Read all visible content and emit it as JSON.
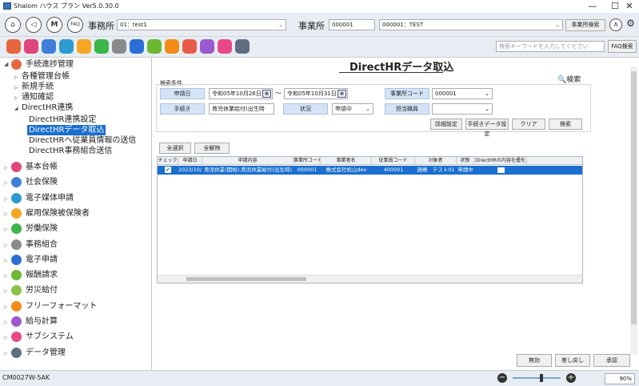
{
  "window": {
    "title": "Shalom ハウス プラン Ver5.0.30.0",
    "minimize": "—",
    "maximize": "☐",
    "close": "✕"
  },
  "toolbar": {
    "home": "⌂",
    "back": "◁",
    "m": "M",
    "faq": "FAQ",
    "office_label": "事務所",
    "office_value": "01：test1",
    "business_label": "事業所",
    "business_code": "000001",
    "business_value": "000001：TEST",
    "business_search": "事業所検索",
    "collapse": "∧",
    "settings": "⚙"
  },
  "toolbar2": {
    "icons": [
      {
        "name": "page-icon",
        "color": "#e8663d"
      },
      {
        "name": "edit-icon",
        "color": "#e0457b"
      },
      {
        "name": "cloud-icon",
        "color": "#3f7fd9"
      },
      {
        "name": "search-icon",
        "color": "#2d9bd1"
      },
      {
        "name": "people-icon",
        "color": "#f5a623"
      },
      {
        "name": "person-icon",
        "color": "#3cb54a"
      },
      {
        "name": "building-icon",
        "color": "#8a8a8a"
      },
      {
        "name": "chat-icon",
        "color": "#2b6fd6"
      },
      {
        "name": "chart-icon",
        "color": "#6cb833"
      },
      {
        "name": "doc-icon",
        "color": "#f28c18"
      },
      {
        "name": "list-icon",
        "color": "#e85b4a"
      },
      {
        "name": "pen-icon",
        "color": "#9b59d0"
      },
      {
        "name": "paper-icon",
        "color": "#e84887"
      },
      {
        "name": "camera-icon",
        "color": "#5e6e80"
      }
    ],
    "search_placeholder": "検索キーワードを入力してください",
    "faq_search": "FAQ検索"
  },
  "sidebar": {
    "root": "手続進捗管理",
    "sub": [
      "各種管理台帳",
      "新規手続",
      "通知確認",
      "DirectHR連携"
    ],
    "directhr": [
      "DirectHR連携設定",
      "DirectHRデータ取込",
      "DirectHRへ従業員情報の送信",
      "DirectHR事務組合送信"
    ],
    "groups": [
      {
        "label": "基本台帳",
        "color": "#e0457b"
      },
      {
        "label": "社会保険",
        "color": "#3f7fd9"
      },
      {
        "label": "電子媒体申請",
        "color": "#2d9bd1"
      },
      {
        "label": "雇用保険被保険者",
        "color": "#f5a623"
      },
      {
        "label": "労働保険",
        "color": "#3cb54a"
      },
      {
        "label": "事務組合",
        "color": "#8a8a8a"
      },
      {
        "label": "電子申請",
        "color": "#2b6fd6"
      },
      {
        "label": "報酬請求",
        "color": "#6cb833"
      },
      {
        "label": "労災給付",
        "color": "#8bc34a"
      },
      {
        "label": "フリーフォーマット",
        "color": "#f28c18"
      },
      {
        "label": "給与計算",
        "color": "#9b59d0"
      },
      {
        "label": "サブシステム",
        "color": "#e84887"
      },
      {
        "label": "データ管理",
        "color": "#5e6e80"
      }
    ]
  },
  "main": {
    "title": "DirectHRデータ取込",
    "search_toggle": "検索",
    "conditions": {
      "legend": "検索条件",
      "apply_date_label": "申請日",
      "date_from": "令和05年10月26日",
      "tilde": "～",
      "date_to": "令和05年10月31日",
      "procedure_label": "手続き",
      "procedure_value": "育児休業給付(出生時",
      "status_label": "状況",
      "status_value": "申請中",
      "office_code_label": "事業所コード",
      "office_code_value": "000001",
      "staff_label": "担当職員",
      "staff_value": "",
      "btn_detail": "詳細設定",
      "btn_proc": "手続きデータ設定",
      "btn_clear": "クリア",
      "btn_search": "検索"
    },
    "select_all": "全選択",
    "deselect_all": "全解除",
    "table": {
      "headers": [
        "チェック",
        "申請日",
        "申請内容",
        "事業所コード",
        "事業者名",
        "従業員コード",
        "対象者",
        "状態",
        "DirectHRの内容を優先"
      ],
      "rows": [
        {
          "checked": "✔",
          "date": "2023/10/31",
          "content": "育児休業(開始),育児休業給付(出生時)",
          "office_code": "000001",
          "company": "株式会社松山dev",
          "emp_code": "400001",
          "target": "週嶋　テスト01",
          "status": "申請中",
          "priority": ""
        }
      ]
    },
    "btn_invalid": "無効",
    "btn_return": "差し戻し",
    "btn_approve": "承認"
  },
  "status": {
    "code": "CM0027W-5AK",
    "zoom_minus": "−",
    "zoom_plus": "+",
    "zoom": "90%"
  }
}
